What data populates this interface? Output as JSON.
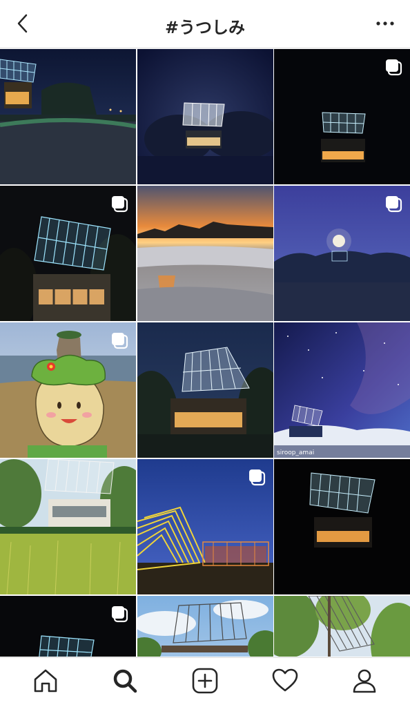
{
  "header": {
    "title": "#うつしみ",
    "back_icon": "chevron-left-icon",
    "more_icon": "more-horizontal-icon"
  },
  "grid": {
    "tiles": [
      {
        "scene": "night-house-field",
        "multiple": false
      },
      {
        "scene": "night-house-glow",
        "multiple": false
      },
      {
        "scene": "night-house-lit",
        "multiple": true
      },
      {
        "scene": "night-house-closeup",
        "multiple": true
      },
      {
        "scene": "sunset-beach",
        "multiple": false
      },
      {
        "scene": "blue-dusk-moon",
        "multiple": true
      },
      {
        "scene": "mascot-beach",
        "multiple": true
      },
      {
        "scene": "dusk-house",
        "multiple": false
      },
      {
        "scene": "milky-way-house",
        "multiple": false,
        "credit": "siroop_amai"
      },
      {
        "scene": "day-house-ricefield",
        "multiple": false
      },
      {
        "scene": "yellow-sculpture-dusk",
        "multiple": true
      },
      {
        "scene": "night-house-dark",
        "multiple": false
      },
      {
        "scene": "night-partial",
        "multiple": true
      },
      {
        "scene": "day-frame-sky",
        "multiple": false
      },
      {
        "scene": "day-frame-trees",
        "multiple": false
      }
    ]
  },
  "bottom_nav": {
    "items": [
      {
        "name": "home",
        "icon": "home-icon"
      },
      {
        "name": "search",
        "icon": "search-icon",
        "active": true
      },
      {
        "name": "new-post",
        "icon": "plus-square-icon"
      },
      {
        "name": "activity",
        "icon": "heart-icon"
      },
      {
        "name": "profile",
        "icon": "user-icon"
      }
    ]
  },
  "colors": {
    "text": "#262626",
    "divider": "#dbdbdb",
    "frame_glow": "#aee8ff",
    "window_light": "#f3b45a"
  }
}
